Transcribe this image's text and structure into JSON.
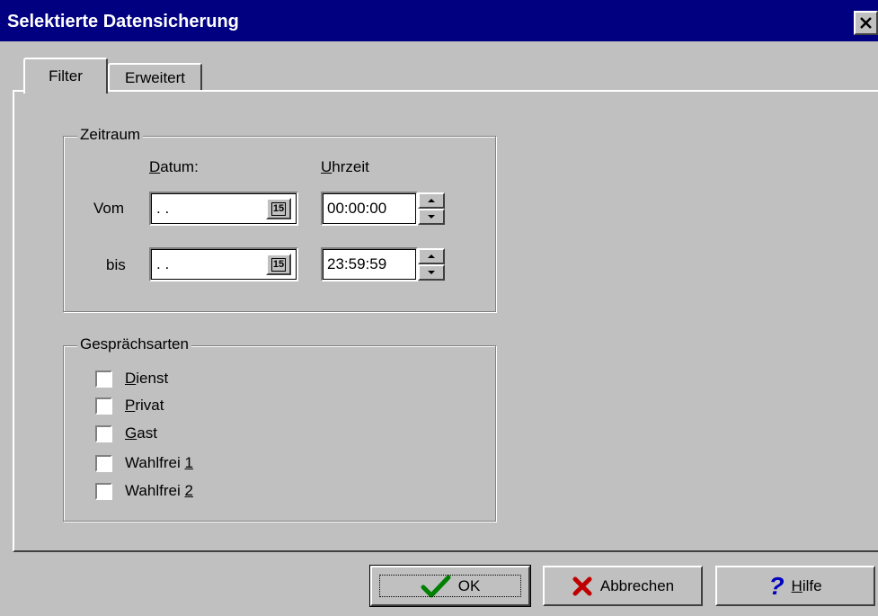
{
  "window": {
    "title": "Selektierte Datensicherung"
  },
  "tabs": [
    {
      "label": "Filter",
      "active": true
    },
    {
      "label": "Erweitert",
      "active": false
    }
  ],
  "zeitraum": {
    "title": "Zeitraum",
    "datum_label": "Datum:",
    "uhrzeit_label": "Uhrzeit",
    "vom_label": "Vom",
    "bis_label": "bis",
    "vom_date": ". .",
    "bis_date": ". .",
    "vom_time": "00:00:00",
    "bis_time": "23:59:59",
    "calendar_glyph": "15"
  },
  "gespraechsarten": {
    "title": "Gesprächsarten",
    "items": [
      {
        "label": "Dienst",
        "checked": false
      },
      {
        "label": "Privat",
        "checked": false
      },
      {
        "label": "Gast",
        "checked": false
      },
      {
        "label_prefix": "Wahlfrei ",
        "label_key": "1",
        "checked": false
      },
      {
        "label_prefix": "Wahlfrei ",
        "label_key": "2",
        "checked": false
      }
    ]
  },
  "buttons": {
    "ok": "OK",
    "cancel": "Abbrechen",
    "help": "Hilfe"
  },
  "colors": {
    "titlebar": "#000080",
    "face": "#c0c0c0",
    "ok_check": "#008000",
    "cancel_x": "#c00000",
    "help_q": "#0000c0"
  }
}
